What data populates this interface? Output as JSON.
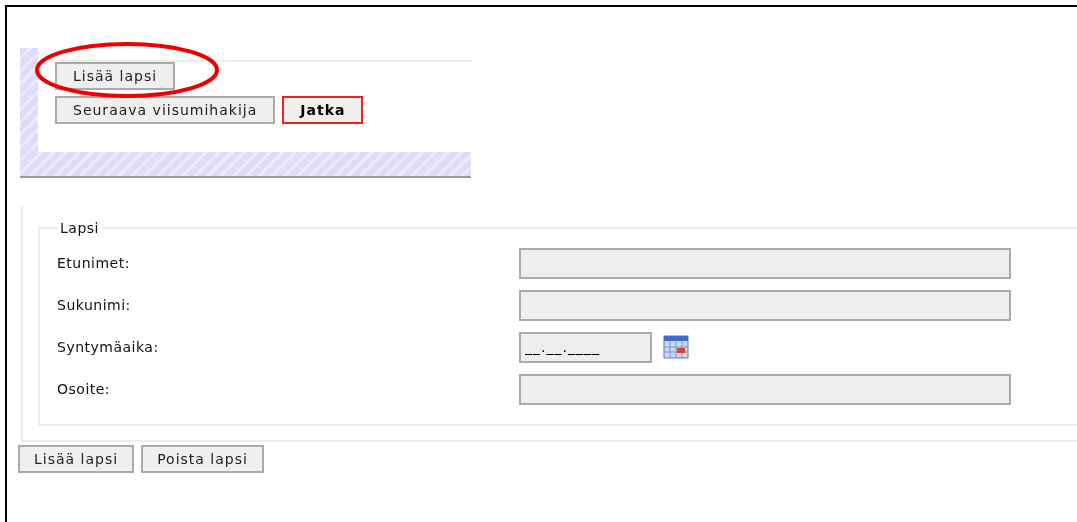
{
  "top_panel": {
    "buttons": [
      {
        "label": "Lisää lapsi",
        "kind": "plain",
        "highlighted": false,
        "circled": true
      },
      {
        "label": "Seuraava viisumihakija",
        "kind": "plain",
        "highlighted": false,
        "circled": false
      },
      {
        "label": "Jatka",
        "kind": "primary",
        "highlighted": true,
        "circled": false
      }
    ]
  },
  "fieldset": {
    "legend": "Lapsi",
    "fields": [
      {
        "label": "Etunimet:",
        "kind": "text"
      },
      {
        "label": "Sukunimi:",
        "kind": "text"
      },
      {
        "label": "Syntymäaika:",
        "kind": "date",
        "value": "__.__.____"
      },
      {
        "label": "Osoite:",
        "kind": "text"
      }
    ]
  },
  "bottom_buttons": [
    {
      "label": "Lisää lapsi"
    },
    {
      "label": "Poista lapsi"
    }
  ]
}
